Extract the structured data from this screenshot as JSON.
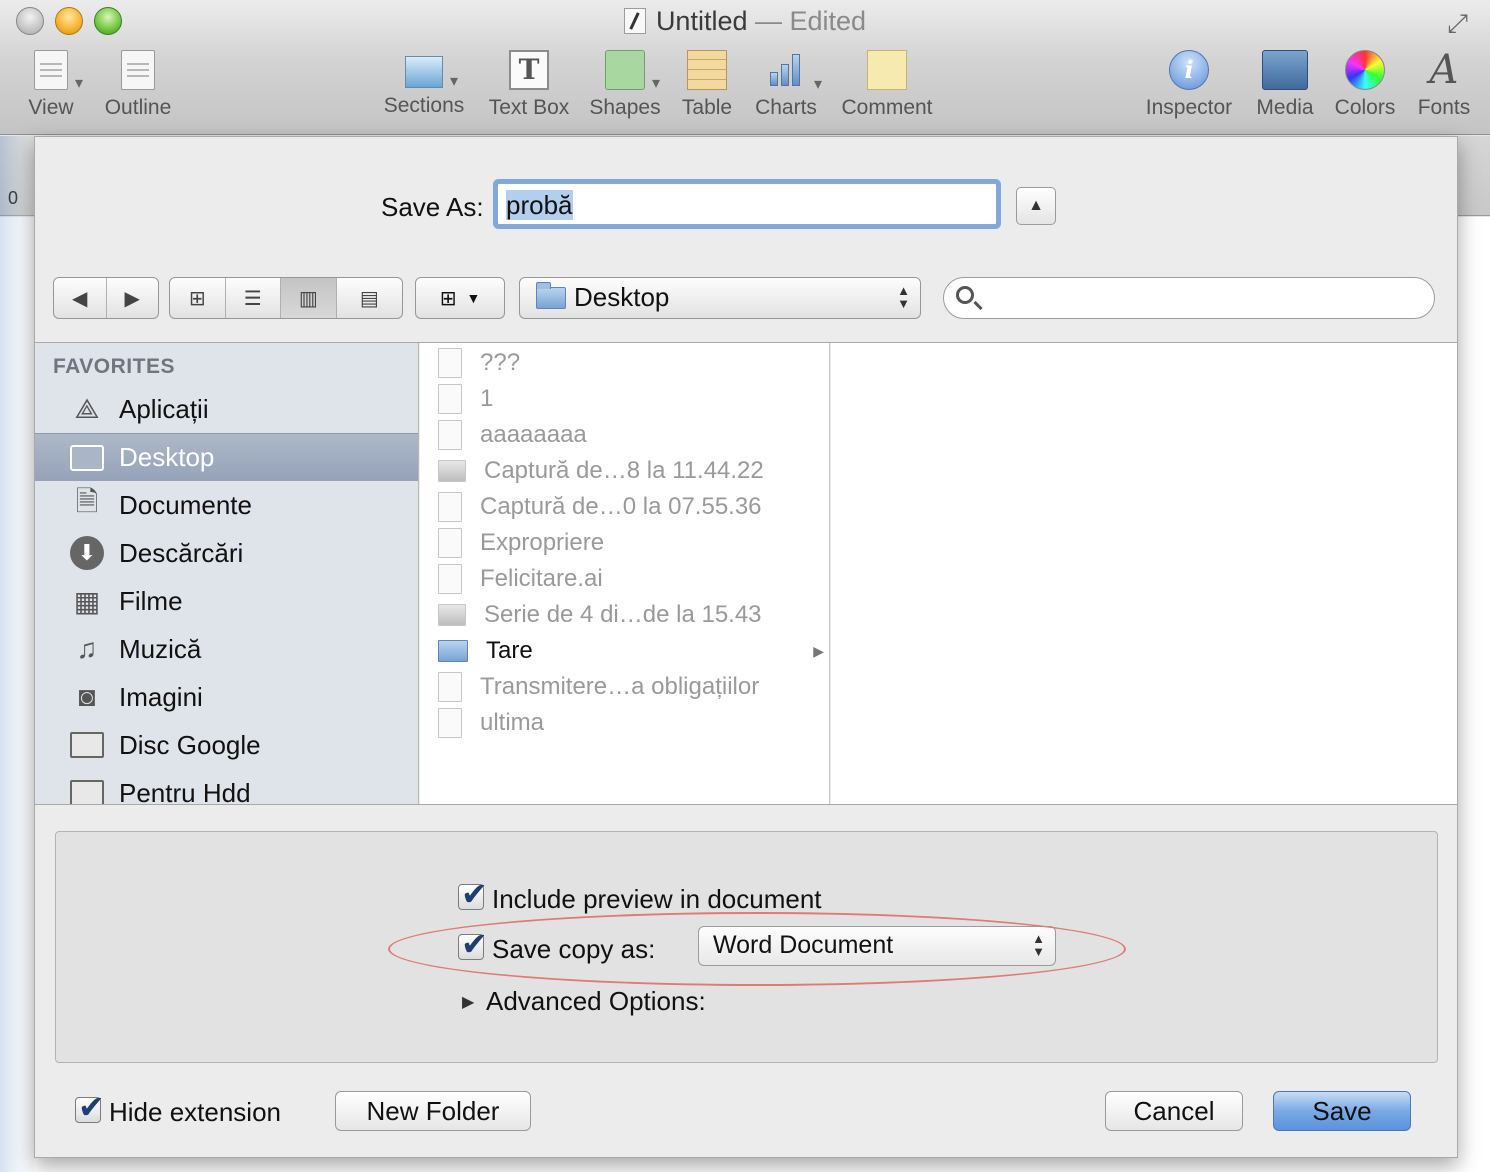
{
  "window": {
    "title": "Untitled",
    "title_suffix": "— Edited"
  },
  "toolbar": {
    "items": [
      {
        "label": "View",
        "icon": "view-icon"
      },
      {
        "label": "Outline",
        "icon": "outline-icon"
      },
      {
        "label": "Sections",
        "icon": "sections-icon"
      },
      {
        "label": "Text Box",
        "icon": "text-box-icon"
      },
      {
        "label": "Shapes",
        "icon": "shapes-icon"
      },
      {
        "label": "Table",
        "icon": "table-icon"
      },
      {
        "label": "Charts",
        "icon": "charts-icon"
      },
      {
        "label": "Comment",
        "icon": "comment-icon"
      },
      {
        "label": "Inspector",
        "icon": "inspector-icon"
      },
      {
        "label": "Media",
        "icon": "media-icon"
      },
      {
        "label": "Colors",
        "icon": "colors-icon"
      },
      {
        "label": "Fonts",
        "icon": "fonts-icon"
      }
    ]
  },
  "ruler": {
    "zero": "0"
  },
  "save_dialog": {
    "save_as_label": "Save As:",
    "filename": "probă",
    "location": "Desktop",
    "search_value": "",
    "sidebar": {
      "heading": "FAVORITES",
      "items": [
        {
          "label": "Aplicații",
          "icon": "applications-icon"
        },
        {
          "label": "Desktop",
          "icon": "desktop-icon",
          "selected": true
        },
        {
          "label": "Documente",
          "icon": "documents-icon"
        },
        {
          "label": "Descărcări",
          "icon": "downloads-icon"
        },
        {
          "label": "Filme",
          "icon": "movies-icon"
        },
        {
          "label": "Muzică",
          "icon": "music-icon"
        },
        {
          "label": "Imagini",
          "icon": "pictures-icon"
        },
        {
          "label": "Disc Google",
          "icon": "folder-icon"
        },
        {
          "label": "Pentru Hdd",
          "icon": "folder-icon"
        }
      ]
    },
    "files": [
      {
        "name": "???",
        "enabled": false,
        "kind": "document"
      },
      {
        "name": "1",
        "enabled": false,
        "kind": "document"
      },
      {
        "name": "aaaaaaaa",
        "enabled": false,
        "kind": "document"
      },
      {
        "name": "Captură de…8 la 11.44.22",
        "enabled": false,
        "kind": "image"
      },
      {
        "name": "Captură de…0 la 07.55.36",
        "enabled": false,
        "kind": "document"
      },
      {
        "name": "Expropriere",
        "enabled": false,
        "kind": "document"
      },
      {
        "name": "Felicitare.ai",
        "enabled": false,
        "kind": "document"
      },
      {
        "name": "Serie de 4 di…de la 15.43",
        "enabled": false,
        "kind": "image"
      },
      {
        "name": "Tare",
        "enabled": true,
        "kind": "folder"
      },
      {
        "name": "Transmitere…a obligațiilor",
        "enabled": false,
        "kind": "document"
      },
      {
        "name": "ultima",
        "enabled": false,
        "kind": "document"
      }
    ],
    "options": {
      "include_preview_label": "Include preview in document",
      "include_preview_checked": true,
      "save_copy_label": "Save copy as:",
      "save_copy_checked": true,
      "save_copy_format": "Word Document",
      "advanced_label": "Advanced Options:"
    },
    "footer": {
      "hide_extension_label": "Hide extension",
      "hide_extension_checked": true,
      "new_folder_label": "New Folder",
      "cancel_label": "Cancel",
      "save_label": "Save"
    }
  },
  "colors": {
    "accent": "#5b93de",
    "selection": "#95a2b8",
    "annotation": "#e07a74"
  }
}
